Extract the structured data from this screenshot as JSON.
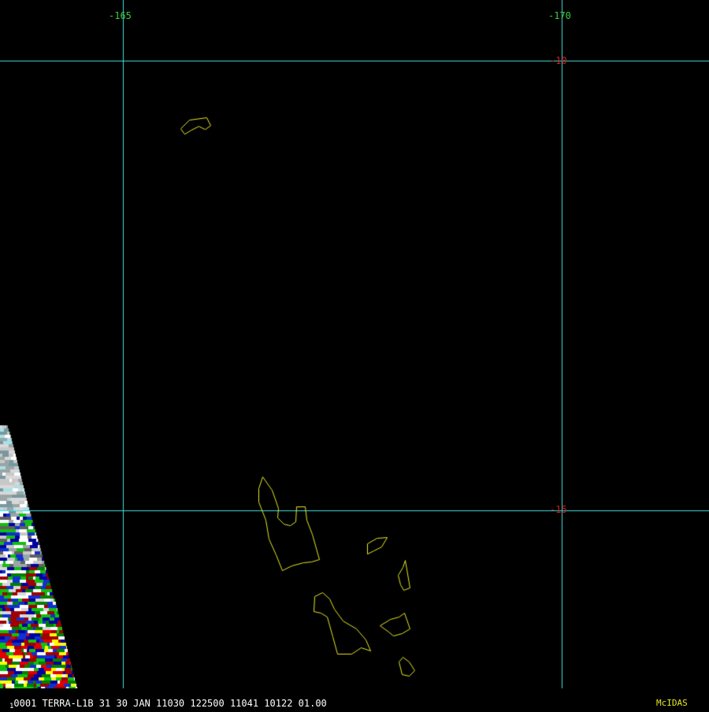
{
  "colors": {
    "background": "#000000",
    "graticule": "#40e0e0",
    "lon_label": "#40c840",
    "lat_label": "#d02020",
    "coastline": "#e8e820",
    "status_text": "#ffffff",
    "brand_text": "#e8e820"
  },
  "graticule": {
    "longitudes": [
      {
        "value": -165,
        "label": "-165"
      },
      {
        "value": -170,
        "label": "-170"
      }
    ],
    "latitudes": [
      {
        "value": -10,
        "label": "-10"
      },
      {
        "value": -15,
        "label": "-15"
      }
    ]
  },
  "status_bar": {
    "prefix": "1",
    "text": "0001 TERRA-L1B 31 30 JAN 11030 122500 11041 10122 01.00",
    "brand": "McIDAS"
  },
  "color_scale": [
    "#1a1a1a",
    "#262626",
    "#333333",
    "#404040",
    "#4d4d4d",
    "#595959",
    "#666666",
    "#737373",
    "#808080",
    "#8c8c8c",
    "#999999",
    "#a6a6a6",
    "#b3b3b3",
    "#bfbfbf",
    "#cccccc",
    "#d9d9d9",
    "#e6e6e6",
    "#f2f2f2",
    "#ffffff",
    "#a8f0f0",
    "#8fd0d0",
    "#7ab0b0",
    "#6a9898",
    "#5a8080",
    "#0000c8",
    "#0000ff",
    "#00a000",
    "#00e000",
    "#800000",
    "#c00000",
    "#ff0000",
    "#ffff00",
    "#c8c800",
    "#808000",
    "#ffffff",
    "#c0c0c0",
    "#808080",
    "#000080",
    "#000060"
  ]
}
